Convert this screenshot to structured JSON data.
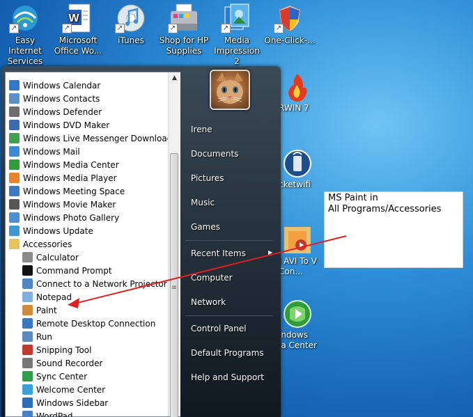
{
  "desktop": {
    "icons": [
      {
        "label": "Easy Internet Services",
        "icon": "easy-internet-icon"
      },
      {
        "label": "Microsoft Office Wo...",
        "icon": "word-icon"
      },
      {
        "label": "iTunes",
        "icon": "itunes-icon"
      },
      {
        "label": "Shop for HP Supplies",
        "icon": "hp-printer-icon"
      },
      {
        "label": "Media Impression 2",
        "icon": "media-impression-icon"
      },
      {
        "label": "One-Click-...",
        "icon": "security-shield-icon"
      }
    ],
    "side_icons": [
      {
        "label": "RWIN 7",
        "icon": "flame-icon"
      },
      {
        "label": "cketwifi",
        "icon": "wifi-icon"
      },
      {
        "label": "l AVI To V Con...",
        "icon": "converter-icon"
      },
      {
        "label": "indows ia Center",
        "icon": "media-center-icon"
      }
    ]
  },
  "start_menu": {
    "programs": [
      {
        "label": "Windows Calendar",
        "indent": false,
        "color": "#2f79c8"
      },
      {
        "label": "Windows Contacts",
        "indent": false,
        "color": "#5b8fc9"
      },
      {
        "label": "Windows Defender",
        "indent": false,
        "color": "#6d6d6d"
      },
      {
        "label": "Windows DVD Maker",
        "indent": false,
        "color": "#3a6ab0"
      },
      {
        "label": "Windows Live Messenger Download",
        "indent": false,
        "color": "#3fa34d"
      },
      {
        "label": "Windows Mail",
        "indent": false,
        "color": "#3c8ad6"
      },
      {
        "label": "Windows Media Center",
        "indent": false,
        "color": "#2f9e3a"
      },
      {
        "label": "Windows Media Player",
        "indent": false,
        "color": "#e8832a"
      },
      {
        "label": "Windows Meeting Space",
        "indent": false,
        "color": "#3b7bc6"
      },
      {
        "label": "Windows Movie Maker",
        "indent": false,
        "color": "#555555"
      },
      {
        "label": "Windows Photo Gallery",
        "indent": false,
        "color": "#4a90d0"
      },
      {
        "label": "Windows Update",
        "indent": false,
        "color": "#3d9ad0"
      },
      {
        "label": "Accessories",
        "indent": false,
        "color": "#e8c35a"
      },
      {
        "label": "Calculator",
        "indent": true,
        "color": "#8a8a8a"
      },
      {
        "label": "Command Prompt",
        "indent": true,
        "color": "#111111"
      },
      {
        "label": "Connect to a Network Projector",
        "indent": true,
        "color": "#4f86c0"
      },
      {
        "label": "Notepad",
        "indent": true,
        "color": "#7fb0e0"
      },
      {
        "label": "Paint",
        "indent": true,
        "color": "#d08a3c"
      },
      {
        "label": "Remote Desktop Connection",
        "indent": true,
        "color": "#3a78c0"
      },
      {
        "label": "Run",
        "indent": true,
        "color": "#5a8ac0"
      },
      {
        "label": "Snipping Tool",
        "indent": true,
        "color": "#c0392b"
      },
      {
        "label": "Sound Recorder",
        "indent": true,
        "color": "#777777"
      },
      {
        "label": "Sync Center",
        "indent": true,
        "color": "#2e9e4a"
      },
      {
        "label": "Welcome Center",
        "indent": true,
        "color": "#3aa0d8"
      },
      {
        "label": "Windows Sidebar",
        "indent": true,
        "color": "#2a6fb8"
      },
      {
        "label": "WordPad",
        "indent": true,
        "color": "#4a80c8"
      }
    ],
    "right_pane": [
      {
        "label": "Irene",
        "name": "user-name"
      },
      {
        "label": "Documents",
        "name": "documents"
      },
      {
        "label": "Pictures",
        "name": "pictures"
      },
      {
        "label": "Music",
        "name": "music"
      },
      {
        "label": "Games",
        "name": "games"
      },
      {
        "label": "Recent Items",
        "name": "recent-items"
      },
      {
        "label": "Computer",
        "name": "computer"
      },
      {
        "label": "Network",
        "name": "network"
      },
      {
        "label": "Control Panel",
        "name": "control-panel"
      },
      {
        "label": "Default Programs",
        "name": "default-programs"
      },
      {
        "label": "Help and Support",
        "name": "help-and-support"
      }
    ],
    "submenu_arrow": "▶"
  },
  "annotation": {
    "line1": "MS Paint in",
    "line2": "All Programs/Accessories",
    "arrow_color": "#e02020"
  },
  "scrollbar": {
    "up": "▲",
    "grip": "≡"
  }
}
